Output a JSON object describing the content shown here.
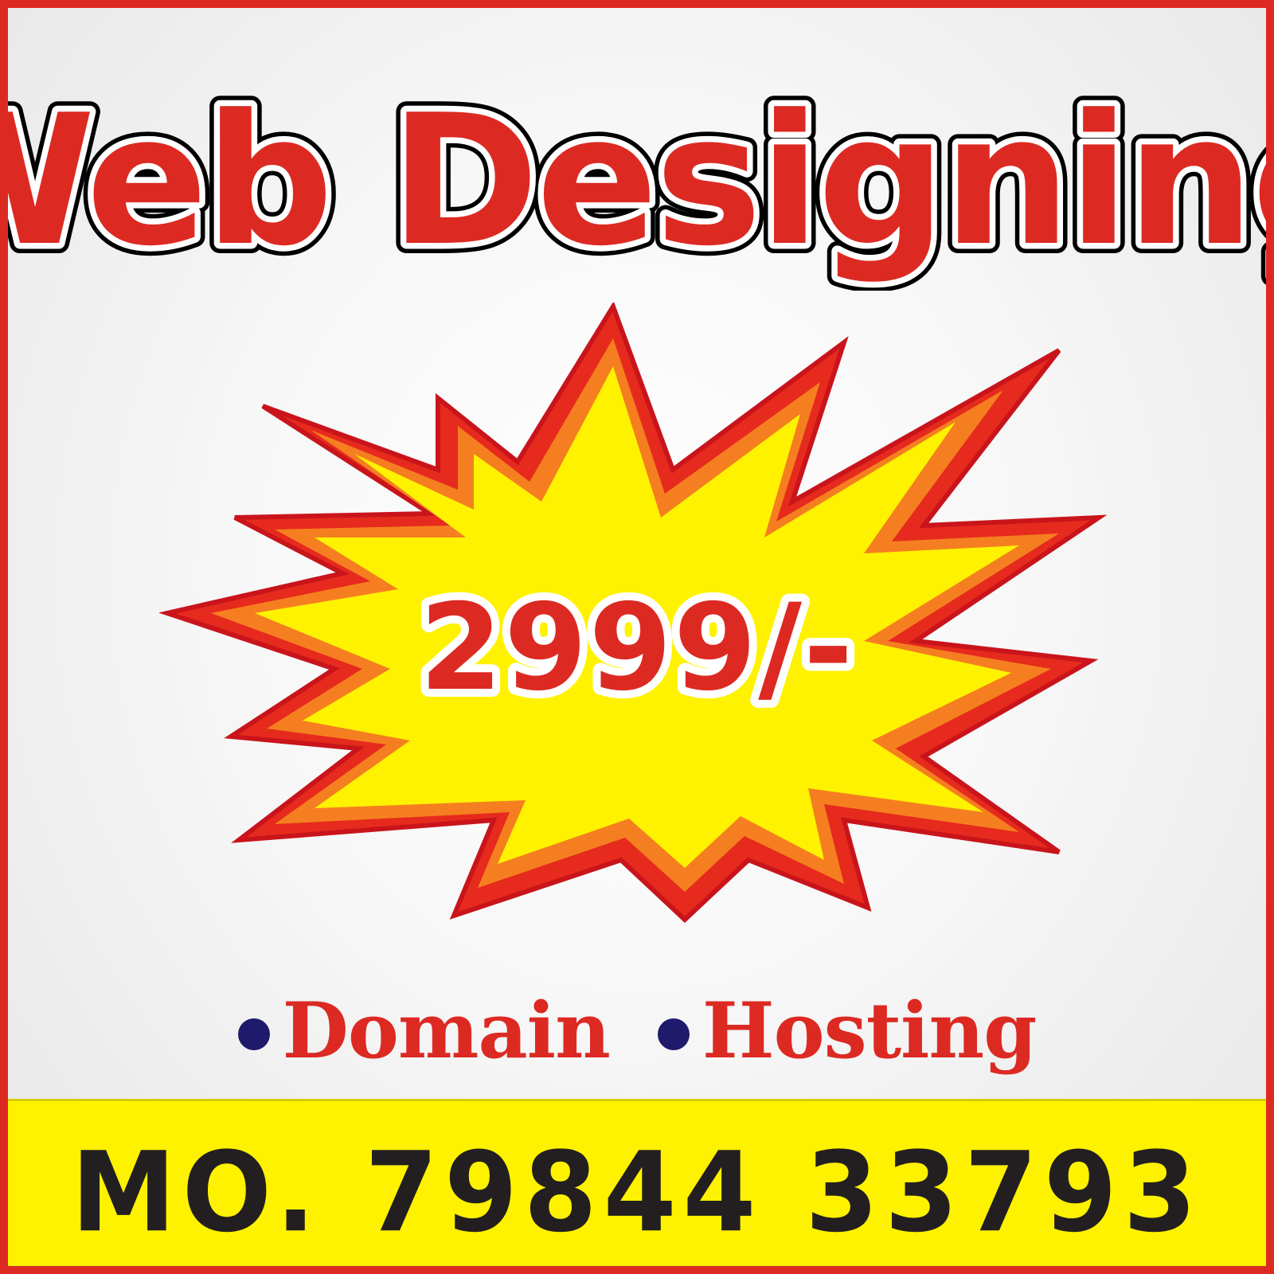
{
  "headline": "Web Designing",
  "price": "2999/-",
  "services": [
    {
      "label": "Domain"
    },
    {
      "label": "Hosting"
    }
  ],
  "contact": "MO. 79844 33793",
  "colors": {
    "red": "#dc2a23",
    "yellow": "#fef200",
    "bullet": "#1f1a6b",
    "dark_text": "#231f20"
  }
}
